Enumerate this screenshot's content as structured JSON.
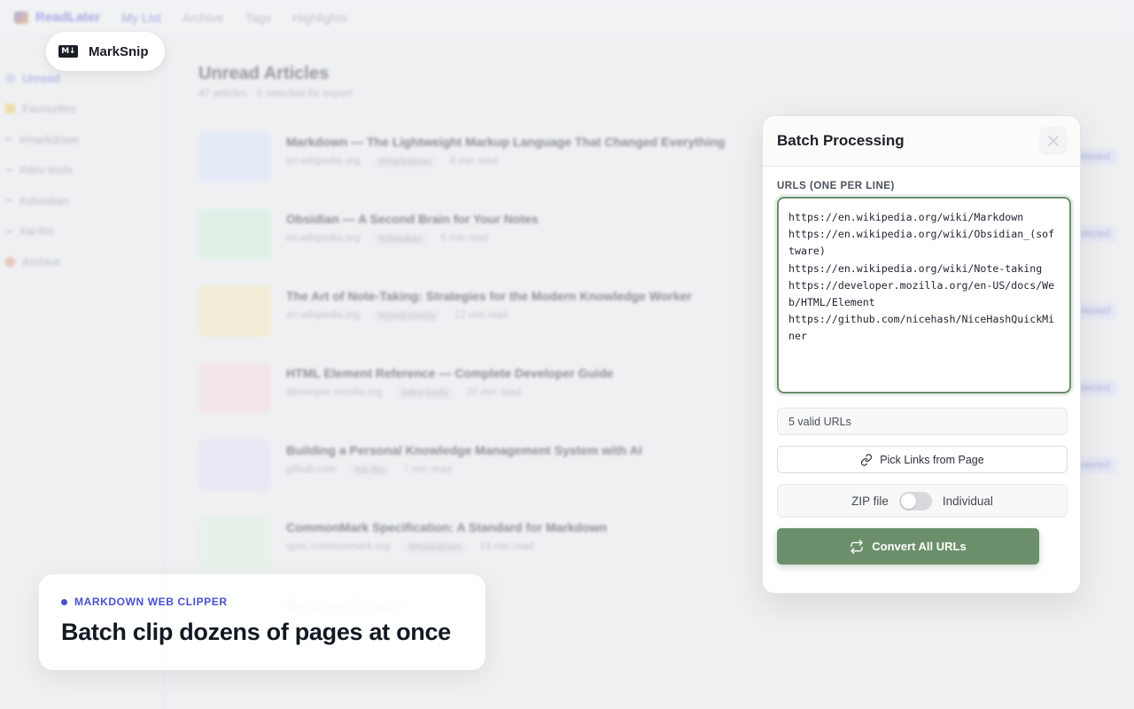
{
  "background_app": {
    "brand": "ReadLater",
    "nav": [
      "My List",
      "Archive",
      "Tags",
      "Highlights"
    ],
    "sidebar": [
      "Unread",
      "Favourites",
      "#markdown",
      "#dev-tools",
      "#obsidian",
      "#ai-llm",
      "Archive"
    ],
    "heading": "Unread Articles",
    "subheading": "47 articles · 5 selected for export",
    "selected_label": "Selected",
    "articles": [
      {
        "title": "Markdown — The Lightweight Markup Language That Changed Everything",
        "domain": "en.wikipedia.org",
        "tag": "#markdown",
        "read": "8 min read",
        "thumb_color": "#dfe7fb",
        "selected": true
      },
      {
        "title": "Obsidian — A Second Brain for Your Notes",
        "domain": "en.wikipedia.org",
        "tag": "#obsidian",
        "read": "5 min read",
        "thumb_color": "#d8f1de",
        "selected": true
      },
      {
        "title": "The Art of Note-Taking: Strategies for the Modern Knowledge Worker",
        "domain": "en.wikipedia.org",
        "tag": "#productivity",
        "read": "12 min read",
        "thumb_color": "#f7ecc2",
        "selected": true
      },
      {
        "title": "HTML Element Reference — Complete Developer Guide",
        "domain": "developer.mozilla.org",
        "tag": "#dev-tools",
        "read": "20 min read",
        "thumb_color": "#f6dde6",
        "selected": true
      },
      {
        "title": "Building a Personal Knowledge Management System with AI",
        "domain": "github.com",
        "tag": "#ai-llm",
        "read": "7 min read",
        "thumb_color": "#e6e2f6",
        "selected": true
      },
      {
        "title": "CommonMark Specification: A Standard for Markdown",
        "domain": "spec.commonmark.org",
        "tag": "#markdown",
        "read": "15 min read",
        "thumb_color": "#e3f2e5",
        "selected": false
      },
      {
        "title": "Markdown Prompts",
        "domain": "",
        "tag": "",
        "read": "",
        "thumb_color": "#f0f1f3",
        "selected": false
      }
    ]
  },
  "badge": {
    "icon": "markdown-icon",
    "icon_text": "M↓",
    "label": "MarkSnip"
  },
  "caption": {
    "eyebrow": "MARKDOWN WEB CLIPPER",
    "title": "Batch clip dozens of pages at once",
    "accent": "#4a4fcf"
  },
  "panel": {
    "title": "Batch Processing",
    "close_icon": "close-icon",
    "field_label": "URLS (ONE PER LINE)",
    "urls_value": "https://en.wikipedia.org/wiki/Markdown\nhttps://en.wikipedia.org/wiki/Obsidian_(software)\nhttps://en.wikipedia.org/wiki/Note-taking\nhttps://developer.mozilla.org/en-US/docs/Web/HTML/Element\nhttps://github.com/nicehash/NiceHashQuickMiner",
    "valid_count": "5 valid URLs",
    "pick_links_label": "Pick Links from Page",
    "pick_links_icon": "link-icon",
    "toggle_left": "ZIP file",
    "toggle_right": "Individual",
    "toggle_state": "off",
    "convert_label": "Convert All URLs",
    "convert_icon": "repeat-icon",
    "accent_color": "#6b8f6b"
  }
}
